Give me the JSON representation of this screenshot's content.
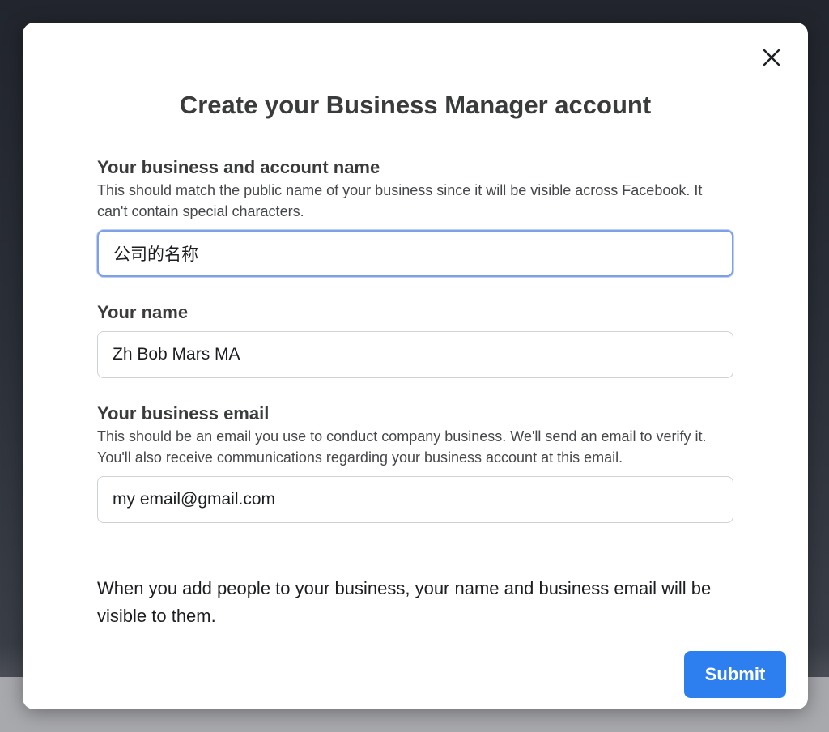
{
  "dialog": {
    "title": "Create your Business Manager account",
    "close_icon": "close-icon"
  },
  "fields": {
    "business_name": {
      "label": "Your business and account name",
      "help": "This should match the public name of your business since it will be visible across Facebook. It can't contain special characters.",
      "value": "公司的名称"
    },
    "your_name": {
      "label": "Your name",
      "value": "Zh Bob Mars MA"
    },
    "business_email": {
      "label": "Your business email",
      "help": "This should be an email you use to conduct company business. We'll send an email to verify it. You'll also receive communications regarding your business account at this email.",
      "value": "my email@gmail.com"
    }
  },
  "note": "When you add people to your business, your name and business email will be visible to them.",
  "actions": {
    "submit_label": "Submit"
  },
  "colors": {
    "accent": "#2d7ff0",
    "focus_border": "#7f9fe6"
  }
}
